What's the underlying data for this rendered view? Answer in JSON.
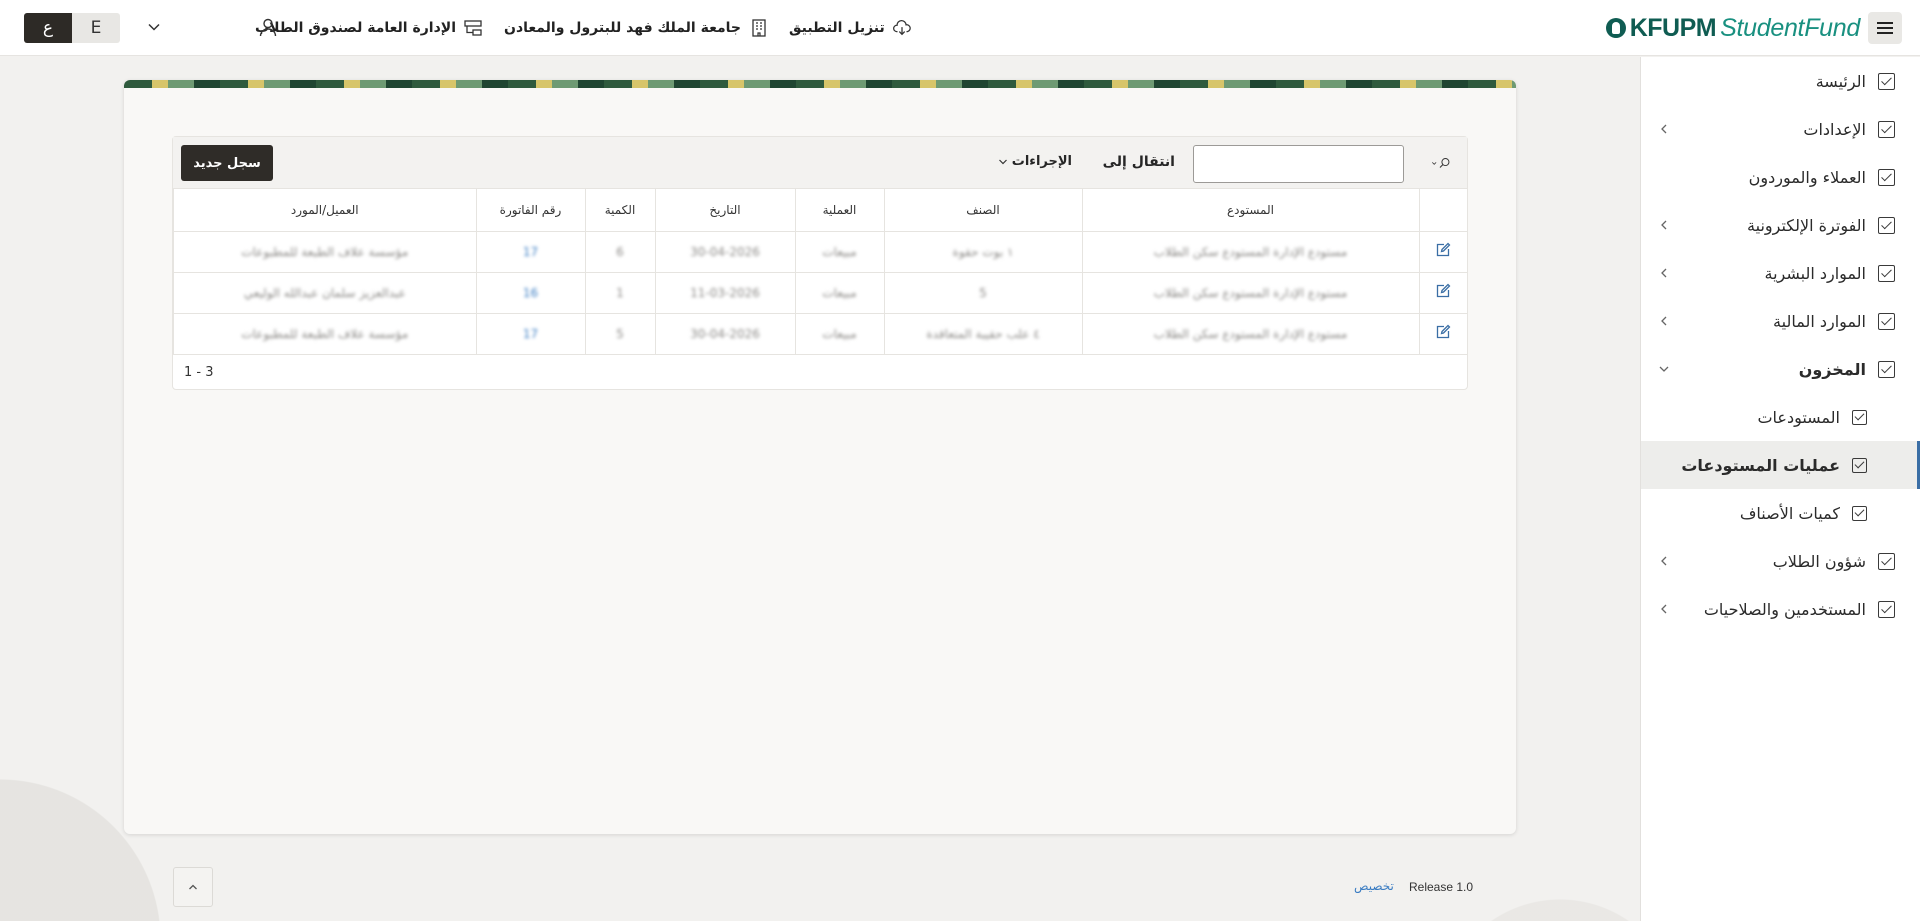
{
  "app": {
    "brand_strong": "KFUPM",
    "brand_light": "StudentFund",
    "colors": {
      "brand": "#0f5c52",
      "accent": "#3a7cc2",
      "dark_button": "#2f2c28"
    }
  },
  "header": {
    "download_app": "تنزيل التطبيق",
    "university": "جامعة الملك فهد للبترول والمعادن",
    "department": "الإدارة العامة لصندوق الطلاب",
    "lang_ar": "ع",
    "lang_en": "E"
  },
  "sidebar": {
    "items": [
      {
        "label": "الرئيسة",
        "has_children": false
      },
      {
        "label": "الإعدادات",
        "has_children": true
      },
      {
        "label": "العملاء والموردون",
        "has_children": false
      },
      {
        "label": "الفوترة الإلكترونية",
        "has_children": true
      },
      {
        "label": "الموارد البشرية",
        "has_children": true
      },
      {
        "label": "الموارد المالية",
        "has_children": true
      },
      {
        "label": "المخزون",
        "has_children": true,
        "expanded": true
      },
      {
        "label": "المستودعات"
      },
      {
        "label": "عمليات المستودعات",
        "active": true
      },
      {
        "label": "كميات الأصناف"
      },
      {
        "label": "شؤون الطلاب",
        "has_children": true
      },
      {
        "label": "المستخدمين والصلاحيات",
        "has_children": true
      }
    ]
  },
  "report": {
    "toolbar": {
      "goto_label": "انتقال إلى",
      "actions_label": "الإجراءات",
      "new_record_label": "سجل جديد",
      "search_value": ""
    },
    "columns": [
      "المستودع",
      "الصنف",
      "العملية",
      "التاريخ",
      "الكمية",
      "رقم الفاتورة",
      "العميل/المورد"
    ],
    "rows": [
      [
        "مستودع الإدارة المستودع سكن الطلاب",
        "١ بوت حقوة",
        "مبيعات",
        "30-04-2026",
        "6",
        "17",
        "مؤسسة علاف الطبعة للمطبوعات"
      ],
      [
        "مستودع الإدارة المستودع سكن الطلاب",
        "5",
        "مبيعات",
        "11-03-2026",
        "1",
        "16",
        "عبدالعزيز سلمان عبدالله الوليعي"
      ],
      [
        "مستودع الإدارة المستودع سكن الطلاب",
        "٤ علب حقيبة المتعاقدة",
        "مبيعات",
        "30-04-2026",
        "5",
        "17",
        "مؤسسة علاف الطبعة للمطبوعات"
      ]
    ],
    "pagination": "1 - 3"
  },
  "footer": {
    "release": "Release 1.0",
    "customize": "تخصيص"
  }
}
